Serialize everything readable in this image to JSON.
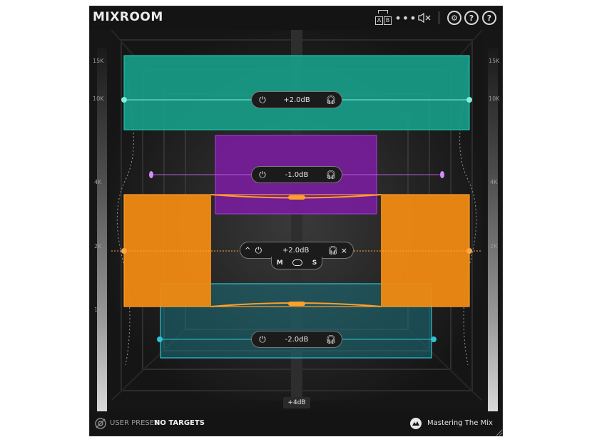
{
  "app": {
    "title": "MIXROOM"
  },
  "toolbar": {
    "ab_a": "A",
    "ab_b": "B",
    "more": "•••",
    "mute": "🔈×",
    "settings": "⚙",
    "help_key": "?",
    "help": "?"
  },
  "freq_scale": {
    "left": [
      "15K",
      "10K",
      "4K",
      "2K",
      "1K"
    ],
    "right": [
      "15K",
      "10K",
      "4K",
      "2K",
      "1K"
    ]
  },
  "bands": [
    {
      "name": "high",
      "color": "#19a590",
      "gain": "+2.0dB"
    },
    {
      "name": "upper-mid",
      "color": "#8a1fb0",
      "gain": "-1.0dB"
    },
    {
      "name": "mid",
      "color": "#f08a12",
      "gain": "+2.0dB",
      "selected": true,
      "collapse": "^",
      "close": "×",
      "mode_m": "M",
      "mode_s": "S"
    },
    {
      "name": "low",
      "color": "#1a8fa0",
      "gain": "-2.0dB"
    }
  ],
  "meter": {
    "db": "+4dB"
  },
  "footer": {
    "preset_label": "USER PRESET",
    "preset_value": "NO TARGETS",
    "brand": "Mastering The Mix"
  }
}
